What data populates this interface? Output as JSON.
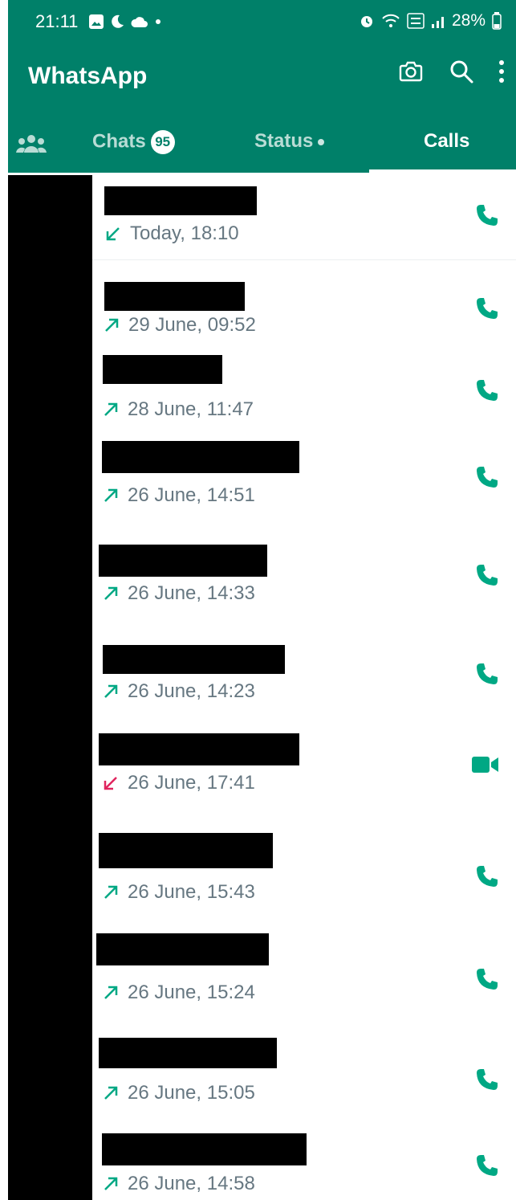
{
  "status_bar": {
    "time": "21:11",
    "battery": "28%"
  },
  "app": {
    "title": "WhatsApp"
  },
  "tabs": [
    {
      "label": "Chats",
      "badge": "95"
    },
    {
      "label": "Status"
    },
    {
      "label": "Calls"
    }
  ],
  "calls": [
    {
      "direction": "incoming",
      "time": "Today, 18:10",
      "type": "voice"
    },
    {
      "direction": "outgoing",
      "time": "29 June, 09:52",
      "type": "voice"
    },
    {
      "direction": "outgoing",
      "time": "28 June, 11:47",
      "type": "voice"
    },
    {
      "direction": "outgoing",
      "time": "26 June, 14:51",
      "type": "voice"
    },
    {
      "direction": "outgoing",
      "time": "26 June, 14:33",
      "type": "voice"
    },
    {
      "direction": "outgoing",
      "time": "26 June, 14:23",
      "type": "voice"
    },
    {
      "direction": "missed",
      "time": "26 June, 17:41",
      "type": "video"
    },
    {
      "direction": "outgoing",
      "time": "26 June, 15:43",
      "type": "voice"
    },
    {
      "direction": "outgoing",
      "time": "26 June, 15:24",
      "type": "voice"
    },
    {
      "direction": "outgoing",
      "time": "26 June, 15:05",
      "type": "voice"
    },
    {
      "direction": "outgoing",
      "time": "26 June, 14:58",
      "type": "voice"
    }
  ],
  "colors": {
    "primary": "#008069",
    "accent": "#00a884",
    "missed": "#e0245e",
    "secondary_text": "#667781"
  }
}
